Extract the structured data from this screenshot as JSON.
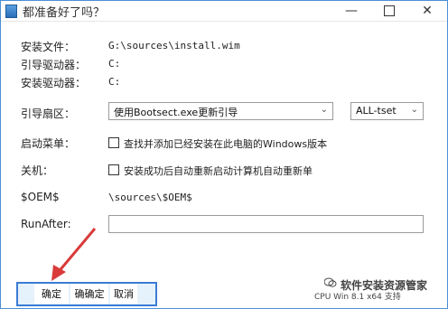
{
  "window": {
    "title": "都准备好了吗？",
    "controls": {
      "minimize": "—",
      "close": "✕"
    }
  },
  "fields": {
    "install_file": {
      "label": "安装文件：",
      "value": "G:\\sources\\install.wim"
    },
    "boot_drive": {
      "label": "引导驱动器：",
      "value": "C:"
    },
    "install_drive": {
      "label": "安装驱动器：",
      "value": "C:"
    },
    "boot_sector": {
      "label": "引导扇区：",
      "selected": "使用Bootsect.exe更新引导",
      "secondary_selected": "ALL-tset"
    },
    "boot_menu": {
      "label": "启动菜单：",
      "checkbox_label": "查找并添加已经安装在此电脑的Windows版本"
    },
    "shutdown": {
      "label": "关机：",
      "checkbox_label": "安装成功后自动重新启动计算机自动重新单"
    },
    "oem": {
      "label": "$OEM$",
      "value": "\\sources\\$OEM$"
    },
    "run_after": {
      "label": "RunAfter:",
      "value": ""
    }
  },
  "buttons": {
    "ok": "确定",
    "ok_confirm": "确确定",
    "cancel": "取消"
  },
  "footer": {
    "status": "CPU Win 8.1 x64 支持",
    "watermark": "软件安装资源管家"
  },
  "colors": {
    "accent": "#3a7bd5",
    "arrow": "#d93a3a"
  }
}
